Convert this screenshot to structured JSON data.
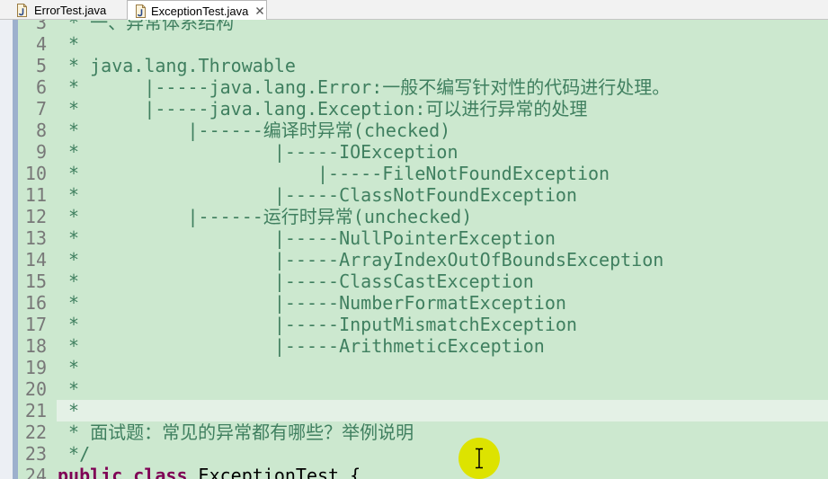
{
  "editor_tabs": [
    {
      "label": "ErrorTest.java",
      "icon": "java-file-icon",
      "active": false
    },
    {
      "label": "ExceptionTest.java",
      "icon": "java-file-icon",
      "active": true,
      "close_icon": "close-icon"
    }
  ],
  "editor": {
    "colors": {
      "background": "#cce8cf",
      "current_line": "#e4f1e6",
      "comment": "#3f7f5f",
      "keyword": "#7f0055",
      "line_number": "#787878",
      "text": "#000000"
    },
    "lines": [
      {
        "number": "3",
        "text": " * 一、异常体系结构"
      },
      {
        "number": "4",
        "text": " *"
      },
      {
        "number": "5",
        "text": " * java.lang.Throwable"
      },
      {
        "number": "6",
        "text": " *      |-----java.lang.Error:一般不编写针对性的代码进行处理。"
      },
      {
        "number": "7",
        "text": " *      |-----java.lang.Exception:可以进行异常的处理"
      },
      {
        "number": "8",
        "text": " *          |------编译时异常(checked)"
      },
      {
        "number": "9",
        "text": " *                  |-----IOException"
      },
      {
        "number": "10",
        "text": " *                      |-----FileNotFoundException"
      },
      {
        "number": "11",
        "text": " *                  |-----ClassNotFoundException"
      },
      {
        "number": "12",
        "text": " *          |------运行时异常(unchecked)"
      },
      {
        "number": "13",
        "text": " *                  |-----NullPointerException"
      },
      {
        "number": "14",
        "text": " *                  |-----ArrayIndexOutOfBoundsException"
      },
      {
        "number": "15",
        "text": " *                  |-----ClassCastException"
      },
      {
        "number": "16",
        "text": " *                  |-----NumberFormatException"
      },
      {
        "number": "17",
        "text": " *                  |-----InputMismatchException"
      },
      {
        "number": "18",
        "text": " *                  |-----ArithmeticException"
      },
      {
        "number": "19",
        "text": " *"
      },
      {
        "number": "20",
        "text": " *"
      },
      {
        "number": "21",
        "text": " *",
        "highlighted": true
      },
      {
        "number": "22",
        "text": " * 面试题：常见的异常都有哪些？举例说明"
      },
      {
        "number": "23",
        "text": " */"
      },
      {
        "number": "24",
        "tokens": [
          {
            "text": "public",
            "keyword": true
          },
          {
            "text": " class",
            "keyword": true
          },
          {
            "text": " ExceptionTest {",
            "keyword": false
          }
        ]
      }
    ]
  },
  "mouse_pointer": {
    "icon": "i-beam-cursor-icon",
    "highlight_color": "#dde300"
  }
}
